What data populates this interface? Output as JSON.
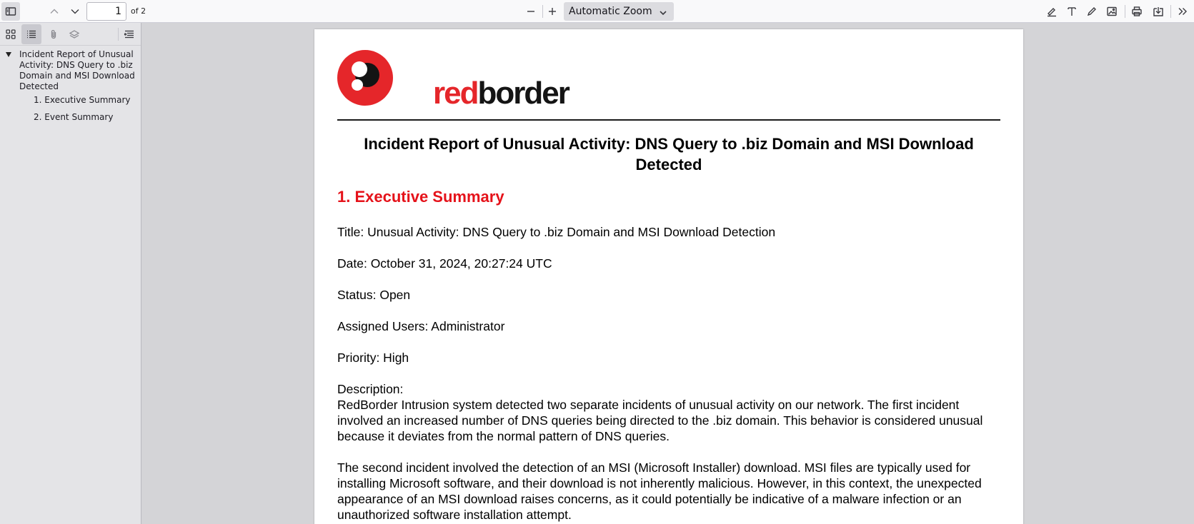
{
  "toolbar": {
    "page_number": "1",
    "page_count": "of 2",
    "zoom_value": "Automatic Zoom",
    "icons": [
      "sidebar-toggle-icon",
      "previous-page-icon",
      "next-page-icon",
      "zoom-out-icon",
      "zoom-in-icon",
      "chevron-down-icon",
      "highlight-icon",
      "text-icon",
      "draw-icon",
      "image-icon",
      "print-icon",
      "save-icon",
      "more-tools-icon"
    ]
  },
  "sidebar": {
    "icons": [
      "thumbnails-icon",
      "outline-icon",
      "attachments-icon",
      "layers-icon",
      "current-outline-item-icon"
    ],
    "outline": {
      "title": "Incident Report of Unusual Activity: DNS Query to .biz Domain and MSI Download Detected",
      "items": [
        "1. Executive Summary",
        "2. Event Summary"
      ]
    }
  },
  "document": {
    "logo": {
      "part1": "red",
      "part2": "border",
      "colors": {
        "red": "#e5262a",
        "dark": "#141414"
      }
    },
    "title": "Incident Report of Unusual Activity: DNS Query to .biz Domain and MSI Download Detected",
    "section_heading": "1. Executive Summary",
    "lines": {
      "title": "Title: Unusual Activity: DNS Query to .biz Domain and MSI Download Detection",
      "date": "Date: October 31, 2024, 20:27:24 UTC",
      "status": "Status: Open",
      "assigned": "Assigned Users: Administrator",
      "priority": "Priority: High",
      "description_label": "Description:",
      "description_p1": "RedBorder Intrusion system detected two separate incidents of unusual activity on our network. The first incident involved an increased number of DNS queries being directed to the .biz domain. This behavior is considered unusual because it deviates from the normal pattern of DNS queries.",
      "description_p2": "The second incident involved the detection of an MSI (Microsoft Installer) download. MSI files are typically used for installing Microsoft software, and their download is not inherently malicious. However, in this context, the unexpected appearance of an MSI download raises concerns, as it could potentially be indicative of a malware infection or an unauthorized software installation attempt."
    },
    "heading_color": "#e5121a"
  }
}
